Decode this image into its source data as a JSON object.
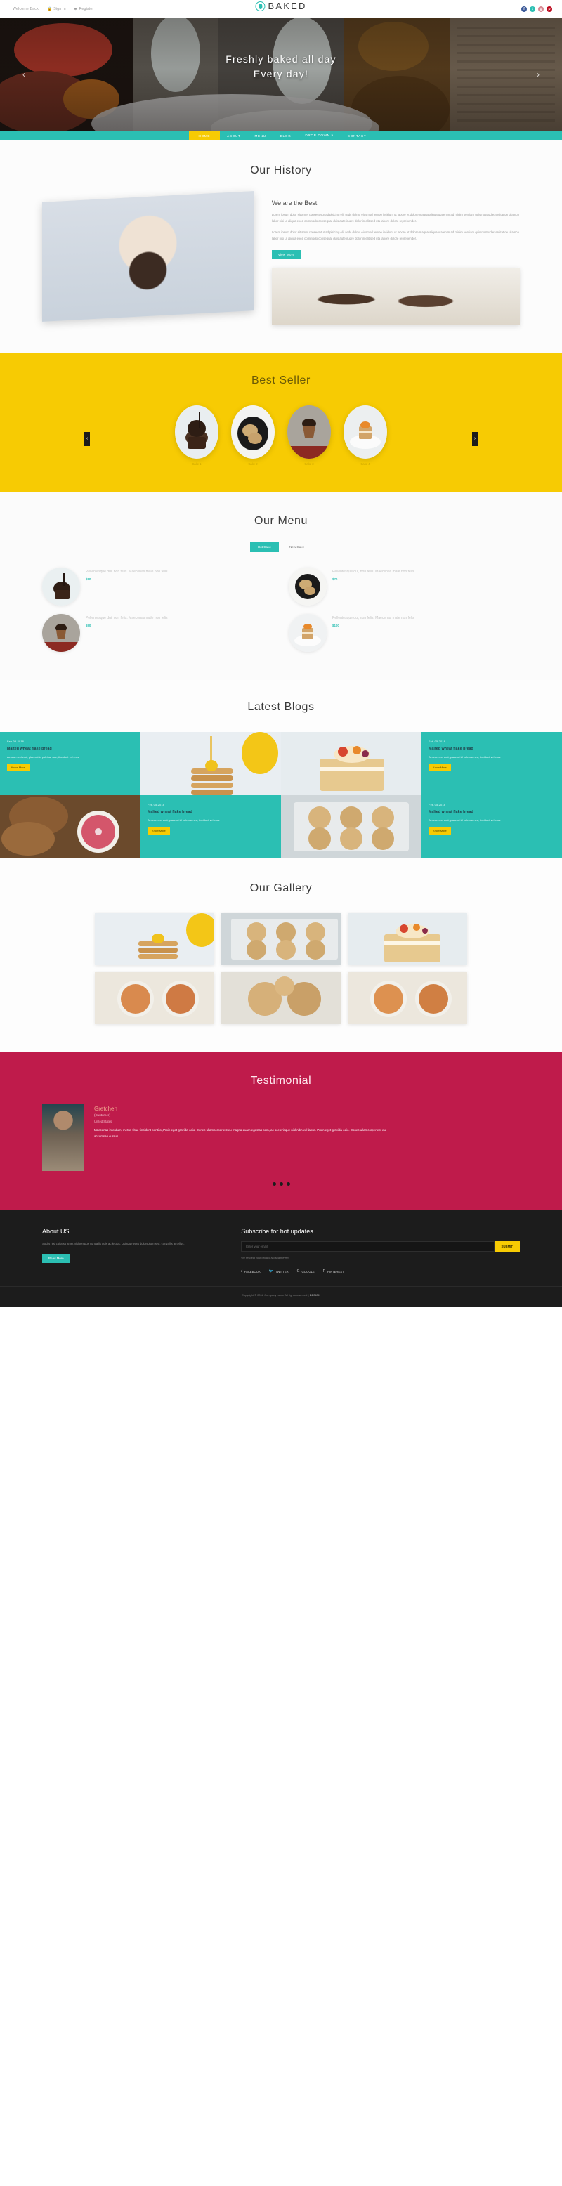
{
  "topbar": {
    "welcome": "Welcome Back!",
    "signin": "Sign In",
    "register": "Register",
    "signin_icon": "lock-icon",
    "register_icon": "user-icon",
    "social": [
      {
        "name": "facebook-icon",
        "glyph": "f",
        "color": "#3b5998"
      },
      {
        "name": "twitter-icon",
        "glyph": "t",
        "color": "#2bbfb3"
      },
      {
        "name": "google-plus-icon",
        "glyph": "g",
        "color": "#d98a94"
      },
      {
        "name": "pinterest-icon",
        "glyph": "p",
        "color": "#bd081c"
      }
    ]
  },
  "brand": {
    "name": "BAKED",
    "mark": "leaf-logo-icon"
  },
  "hero": {
    "line1": "Freshly baked all day",
    "line2": "Every day!",
    "prev_icon": "chevron-left-icon",
    "next_icon": "chevron-right-icon"
  },
  "nav": {
    "items": [
      {
        "label": "HOME",
        "active": true
      },
      {
        "label": "ABOUT",
        "active": false
      },
      {
        "label": "MENU",
        "active": false
      },
      {
        "label": "BLOG",
        "active": false
      },
      {
        "label": "DROP DOWN ▾",
        "active": false
      },
      {
        "label": "CONTACT",
        "active": false
      }
    ]
  },
  "history": {
    "title": "Our History",
    "subtitle": "We are the Best",
    "para1": "Lorem ipsum dolor sit amet consectetur adipisicing elit sedc dolmo eiusmod tempo incidunt ut labore et dolore magna aliqua uta enim ad minim ven iam quis nostrud exercitation ullamco labor nisi ut aliqua exea commodo consequat duis aute irudre dolor in elit sed uta labore dolore reprehender.",
    "para2": "Lorem ipsum dolor sit amet consectetur adipisicing elit sedc dolmo eiusmod tempo incidunt ut labore et dolore magna aliqua uta enim ad minim ven iam quis nostrud exercitation ullamco labor nisi ut aliqua exea commodo consequat duis aute irudre dolor in elit sed uta labore dolore reprehender.",
    "button": "View More"
  },
  "bestseller": {
    "title": "Best Seller",
    "prev_icon": "chevron-left-icon",
    "next_icon": "chevron-right-icon",
    "items": [
      {
        "caption": "Cake 1"
      },
      {
        "caption": "Cake 2"
      },
      {
        "caption": "Cake 3"
      },
      {
        "caption": "Cake 4"
      }
    ]
  },
  "menu": {
    "title": "Our Menu",
    "tabs": [
      {
        "label": "Hot Cake",
        "active": true
      },
      {
        "label": "New Cake",
        "active": false
      }
    ],
    "items": [
      {
        "desc": "Pellentesque dui, non felis. Maecenas male non felis",
        "price": "$80"
      },
      {
        "desc": "Pellentesque dui, non felis. Maecenas male non felis",
        "price": "$70"
      },
      {
        "desc": "Pellentesque dui, non felis. Maecenas male non felis",
        "price": "$90"
      },
      {
        "desc": "Pellentesque dui, non felis. Maecenas male non felis",
        "price": "$100"
      }
    ]
  },
  "blogs": {
    "title": "Latest Blogs",
    "cards": [
      {
        "date": "Feb.05.2018",
        "title": "Malted wheat flake bread",
        "body": "Aenean orci erat, placerat id pulvinar nec, tincidunt vel eros.",
        "button": "Know More"
      },
      {
        "date": "Feb.05.2018",
        "title": "Malted wheat flake bread",
        "body": "Aenean orci erat, placerat id pulvinar nec, tincidunt vel eros.",
        "button": "Know More"
      },
      {
        "date": "Feb.05.2018",
        "title": "Malted wheat flake bread",
        "body": "Aenean orci erat, placerat id pulvinar nec, tincidunt vel eros.",
        "button": "Know More"
      },
      {
        "date": "Feb.05.2018",
        "title": "Malted wheat flake bread",
        "body": "Aenean orci erat, placerat id pulvinar nec, tincidunt vel eros.",
        "button": "Know More"
      }
    ]
  },
  "gallery": {
    "title": "Our Gallery",
    "items": [
      {
        "alt": "pancake-stack"
      },
      {
        "alt": "cookies-tray"
      },
      {
        "alt": "fruit-cake"
      },
      {
        "alt": "grapefruit-slices"
      },
      {
        "alt": "cookies-plate"
      },
      {
        "alt": "orange-slices"
      }
    ]
  },
  "testimonial": {
    "title": "Testimonial",
    "name": "Gretchen",
    "role": "(Customer)",
    "location": "United States",
    "text": "Maecenas interdum, metus vitae tincidunt porttitor,Proin eget gravida odio. Donec ullamcorper est eu magna quam egestas sem, ac scelerisque nisl nibh vel lacus. Proin eget gravida odio. Donec ullamcorper est eu accumsan cursus.",
    "dots": 3
  },
  "footer": {
    "about_title": "About US",
    "about_text": "Sociis nisi cofia sit amet nisl tempus convallis quis ac lectus. Quisque eget dolorsolum sed, convallis at tellus.",
    "about_button": "Read More",
    "subscribe_title": "Subscribe for hot updates",
    "input_placeholder": "Enter your email",
    "submit_label": "SUBMIT",
    "note": "We respect your privacy.No spam ever!",
    "social": [
      {
        "label": "FACEBOOK",
        "icon": "facebook-icon",
        "glyph": "f"
      },
      {
        "label": "TWITTER",
        "icon": "twitter-icon",
        "glyph": "t"
      },
      {
        "label": "GOOGLE",
        "icon": "google-plus-icon",
        "glyph": "g"
      },
      {
        "label": "PINTEREST",
        "icon": "pinterest-icon",
        "glyph": "p"
      }
    ],
    "copyright": "Copyright © 2018 Company name All rights reserved |",
    "copyright_brand": "DESIGN"
  }
}
